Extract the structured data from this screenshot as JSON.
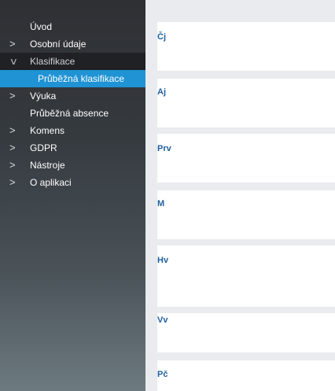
{
  "sidebar": {
    "items": [
      {
        "label": "Úvod",
        "chevron": ""
      },
      {
        "label": "Osobní údaje",
        "chevron": ">"
      },
      {
        "label": "Klasifikace",
        "chevron": "∨"
      },
      {
        "label": "Průběžná klasifikace",
        "chevron": ""
      },
      {
        "label": "Výuka",
        "chevron": ">"
      },
      {
        "label": "Průběžná absence",
        "chevron": ""
      },
      {
        "label": "Komens",
        "chevron": ">"
      },
      {
        "label": "GDPR",
        "chevron": ">"
      },
      {
        "label": "Nástroje",
        "chevron": ">"
      },
      {
        "label": "O aplikaci",
        "chevron": ">"
      }
    ]
  },
  "main": {
    "subjects": [
      {
        "label": "Čj"
      },
      {
        "label": "Aj"
      },
      {
        "label": "Prv"
      },
      {
        "label": "M"
      },
      {
        "label": "Hv"
      },
      {
        "label": "Vv"
      },
      {
        "label": "Pč"
      }
    ]
  },
  "colors": {
    "accent": "#1f93d4",
    "subject_text": "#1f5f9e",
    "sidebar_top": "#2e3034",
    "background": "#e9ebee"
  }
}
